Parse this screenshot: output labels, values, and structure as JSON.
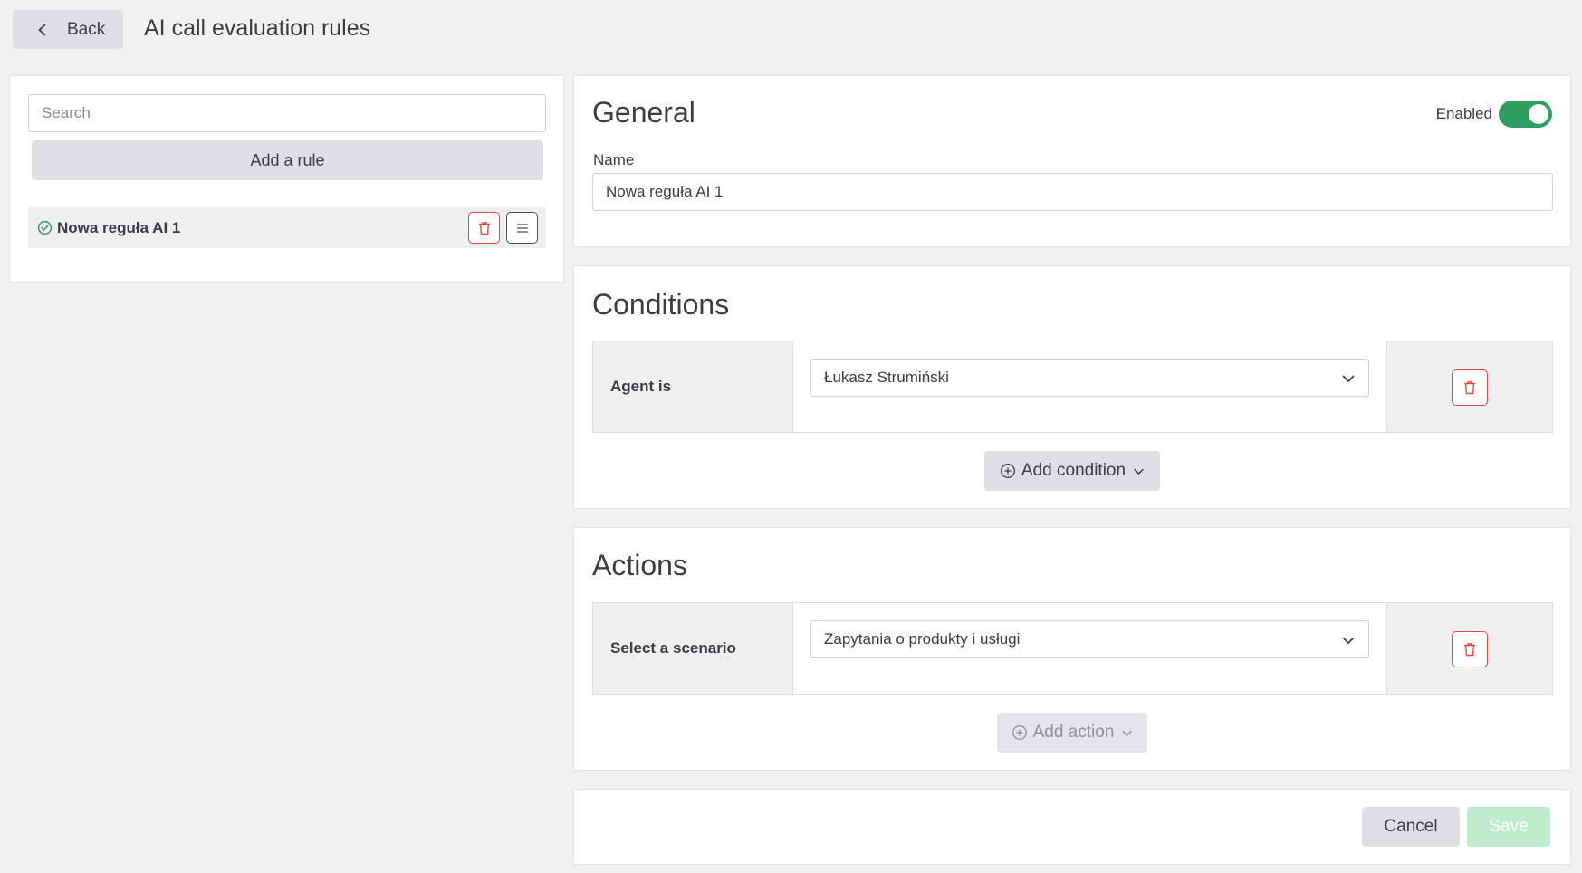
{
  "header": {
    "back_label": "Back",
    "title": "AI call evaluation rules"
  },
  "sidebar": {
    "search_placeholder": "Search",
    "add_rule_label": "Add a rule",
    "rules": [
      {
        "label": "Nowa reguła AI 1",
        "status": "enabled"
      }
    ]
  },
  "general": {
    "title": "General",
    "enabled_label": "Enabled",
    "enabled": true,
    "name_label": "Name",
    "name_value": "Nowa reguła AI 1"
  },
  "conditions": {
    "title": "Conditions",
    "rows": [
      {
        "label": "Agent is",
        "value": "Łukasz Strumiński"
      }
    ],
    "add_label": "Add condition"
  },
  "actions": {
    "title": "Actions",
    "rows": [
      {
        "label": "Select a scenario",
        "value": "Zapytania o produkty i usługi"
      }
    ],
    "add_label": "Add action"
  },
  "footer": {
    "cancel_label": "Cancel",
    "save_label": "Save"
  },
  "colors": {
    "accent_green": "#2e9e5f",
    "danger_red": "#e04646",
    "save_disabled": "#bfeccf",
    "background": "#f0f1f0"
  },
  "icons": {
    "back": "chevron-left-icon",
    "rule_status": "check-circle-icon",
    "delete": "trash-icon",
    "menu": "hamburger-menu-icon",
    "select_caret": "chevron-down-icon",
    "add": "plus-circle-icon"
  }
}
